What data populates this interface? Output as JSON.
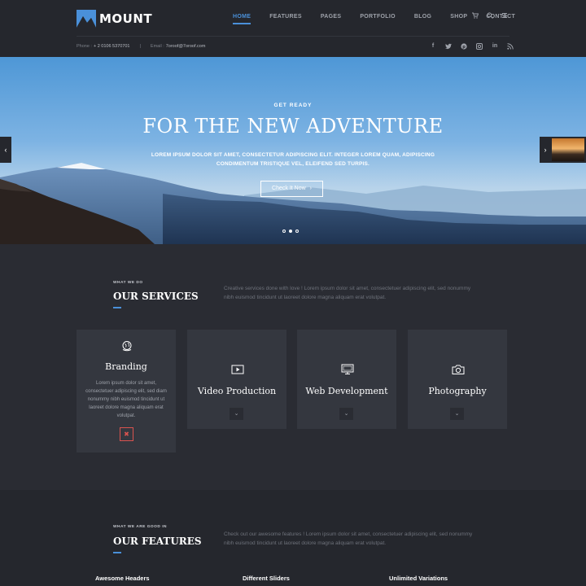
{
  "brand": {
    "name": "MOUNT",
    "accent": "#4a90d9"
  },
  "nav": {
    "items": [
      "HOME",
      "FEATURES",
      "PAGES",
      "PORTFOLIO",
      "BLOG",
      "SHOP",
      "CONTACT"
    ],
    "active": "HOME",
    "icons": [
      "cart-icon",
      "search-icon",
      "menu-icon"
    ]
  },
  "contact": {
    "phone_label": "Phone :",
    "phone": "+ 2 0106 5370701",
    "email_label": "Email :",
    "email": "7oroof@7oroof.com"
  },
  "social": [
    "facebook-icon",
    "twitter-icon",
    "pinterest-icon",
    "instagram-icon",
    "linkedin-icon",
    "rss-icon"
  ],
  "hero": {
    "eyebrow": "GET READY",
    "title": "FOR THE NEW ADVENTURE",
    "subtitle": "LOREM IPSUM DOLOR SIT AMET, CONSECTETUR ADIPISCING ELIT. INTEGER LOREM QUAM, ADIPISCING CONDIMENTUM TRISTIQUE VEL, ELEIFEND SED TURPIS.",
    "button": "Check It Now",
    "slides": 3,
    "active_slide": 2
  },
  "services": {
    "eyebrow": "WHAT WE DO",
    "title": "OUR SERVICES",
    "description": "Creative services done with love ! Lorem ipsum dolor sit amet, consectetuer adipiscing elit, sed nonummy nibh euismod tincidunt ut laoreet dolore magna aliquam erat volutpat.",
    "cards": [
      {
        "title": "Branding",
        "icon": "globe-icon",
        "description": "Lorem ipsum dolor sit amet, consectetuer adipiscing elit, sed diam nonummy nibh euismod tincidunt ut laoreet dolore magna aliquam erat volutpat."
      },
      {
        "title": "Video Production",
        "icon": "video-icon"
      },
      {
        "title": "Web Development",
        "icon": "monitor-icon"
      },
      {
        "title": "Photography",
        "icon": "camera-icon"
      }
    ]
  },
  "features": {
    "eyebrow": "WHAT WE ARE GOOD IN",
    "title": "OUR FEATURES",
    "description": "Check out our awesome features ! Lorem ipsum dolor sit amet, consectetuer adipiscing elit, sed nonummy nibh euismod tincidunt ut laoreet dolore magna aliquam erat volutpat.",
    "items": [
      "Awesome Headers",
      "Different Sliders",
      "Unlimited Variations"
    ]
  }
}
